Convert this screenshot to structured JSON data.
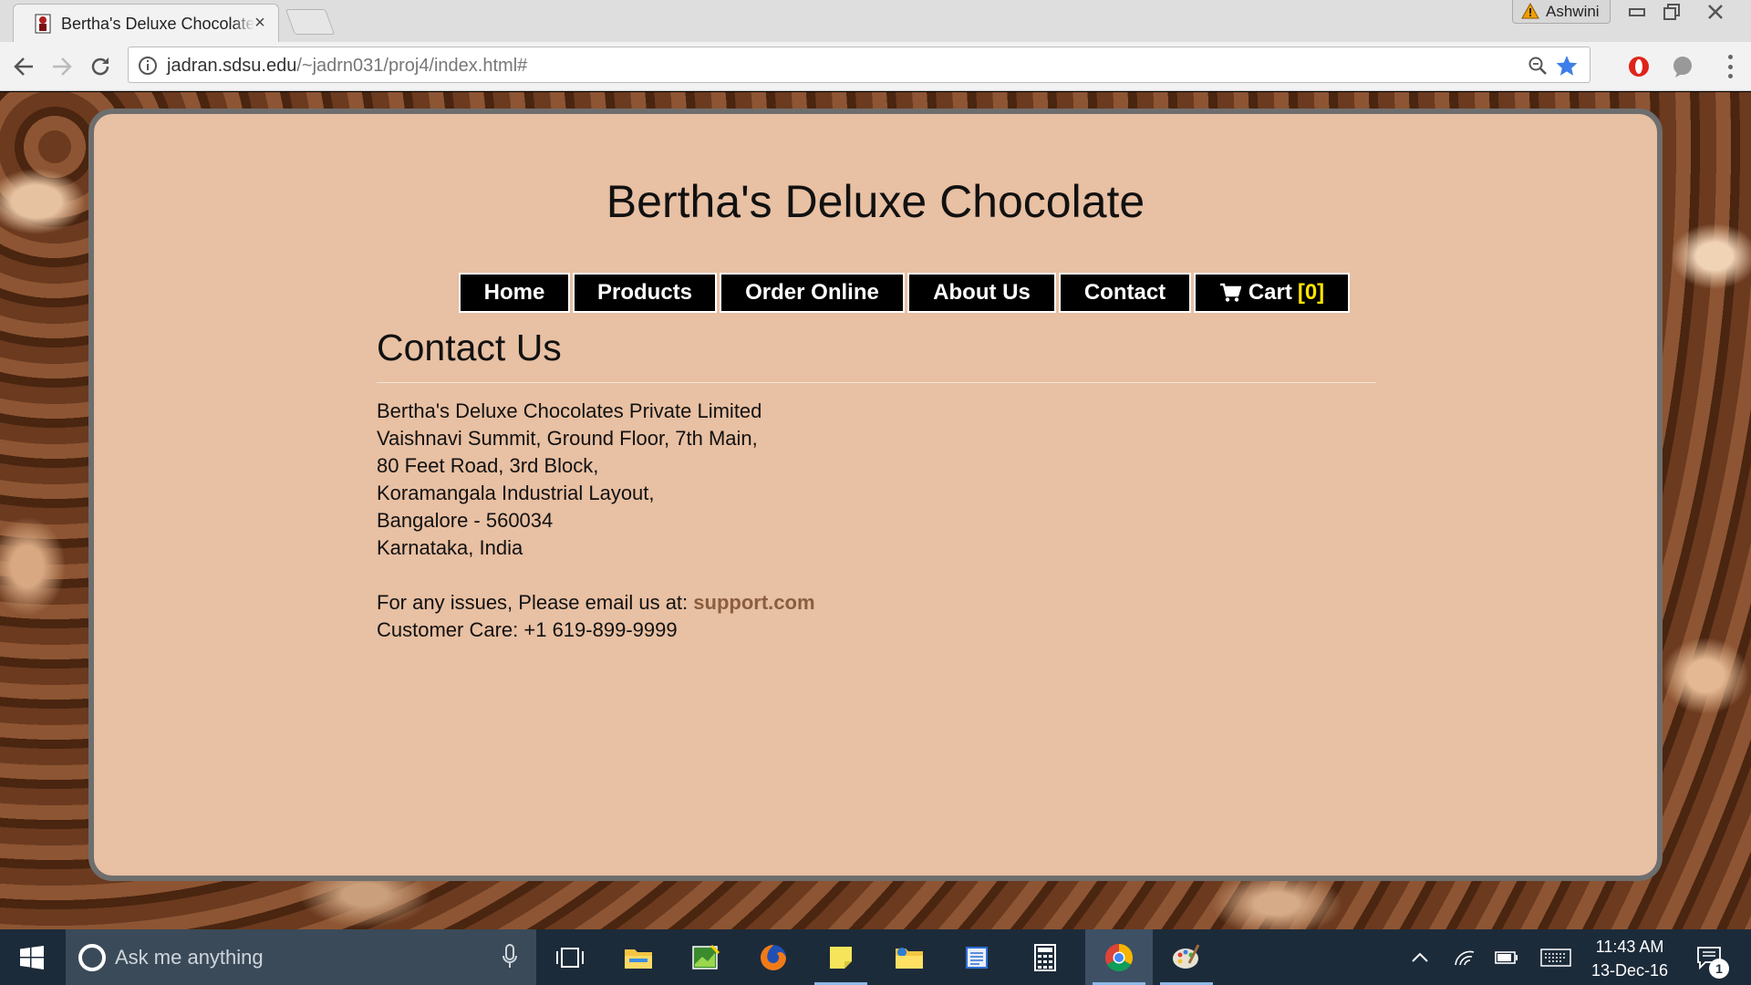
{
  "browser": {
    "tab_title": "Bertha's Deluxe Chocolate",
    "tab_close": "×",
    "profile_name": "Ashwini",
    "url_host": "jadran.sdsu.edu",
    "url_path": "/~jadrn031/proj4/index.html#"
  },
  "site": {
    "title": "Bertha's Deluxe Chocolate",
    "nav": {
      "home": "Home",
      "products": "Products",
      "order_online": "Order Online",
      "about_us": "About Us",
      "contact": "Contact",
      "cart": "Cart",
      "cart_count": "[0]"
    }
  },
  "contact": {
    "heading": "Contact Us",
    "address_lines": [
      "Bertha's Deluxe Chocolates Private Limited",
      "Vaishnavi Summit, Ground Floor, 7th Main,",
      "80 Feet Road, 3rd Block,",
      "Koramangala Industrial Layout,",
      "Bangalore - 560034",
      "Karnataka, India"
    ],
    "email_prefix": "For any issues, Please email us at:",
    "email_link": "support.com",
    "customer_care": "Customer Care: +1 619-899-9999"
  },
  "taskbar": {
    "search_placeholder": "Ask me anything",
    "time": "11:43 AM",
    "date": "13-Dec-16",
    "notification_count": "1"
  }
}
